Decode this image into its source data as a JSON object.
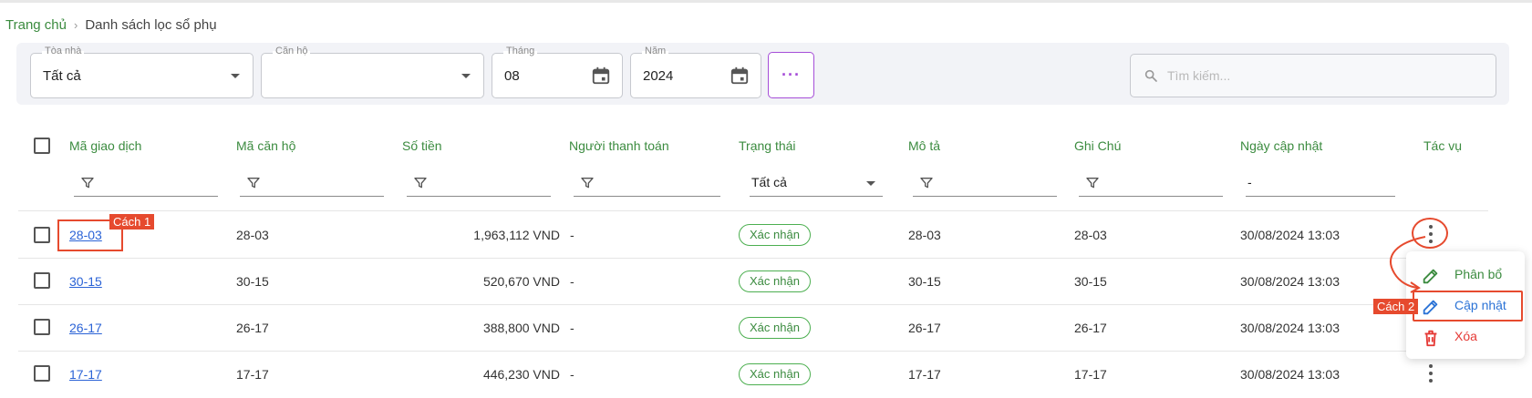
{
  "breadcrumb": {
    "home": "Trang chủ",
    "separator": "›",
    "current": "Danh sách lọc sổ phụ"
  },
  "filters": {
    "building": {
      "label": "Tòa nhà",
      "value": "Tất cả"
    },
    "apartment": {
      "label": "Căn hộ",
      "value": ""
    },
    "month": {
      "label": "Tháng",
      "value": "08"
    },
    "year": {
      "label": "Năm",
      "value": "2024"
    },
    "more_label": "···",
    "search_placeholder": "Tìm kiếm..."
  },
  "table": {
    "headers": [
      "Mã giao dịch",
      "Mã căn hộ",
      "Số tiền",
      "Người thanh toán",
      "Trạng thái",
      "Mô tả",
      "Ghi Chú",
      "Ngày cập nhật",
      "Tác vụ"
    ],
    "status_filter": "Tất cả",
    "date_filter": "-",
    "rows": [
      {
        "code": "28-03",
        "apartment": "28-03",
        "amount": "1,963,112 VND",
        "payer": "-",
        "status": "Xác nhận",
        "description": "28-03",
        "note": "28-03",
        "updated": "30/08/2024 13:03"
      },
      {
        "code": "30-15",
        "apartment": "30-15",
        "amount": "520,670 VND",
        "payer": "-",
        "status": "Xác nhận",
        "description": "30-15",
        "note": "30-15",
        "updated": "30/08/2024 13:03"
      },
      {
        "code": "26-17",
        "apartment": "26-17",
        "amount": "388,800 VND",
        "payer": "-",
        "status": "Xác nhận",
        "description": "26-17",
        "note": "26-17",
        "updated": "30/08/2024 13:03"
      },
      {
        "code": "17-17",
        "apartment": "17-17",
        "amount": "446,230 VND",
        "payer": "-",
        "status": "Xác nhận",
        "description": "17-17",
        "note": "17-17",
        "updated": "30/08/2024 13:03"
      }
    ]
  },
  "action_menu": {
    "allocate": "Phân bổ",
    "update": "Cập nhật",
    "delete": "Xóa"
  },
  "annotations": {
    "method1": "Cách 1",
    "method2": "Cách 2"
  },
  "colors": {
    "accent_green": "#3b8b3f",
    "link_blue": "#2b63d6",
    "purple": "#a64ed8",
    "annotation_red": "#e64a2e",
    "delete_red": "#e53935"
  }
}
